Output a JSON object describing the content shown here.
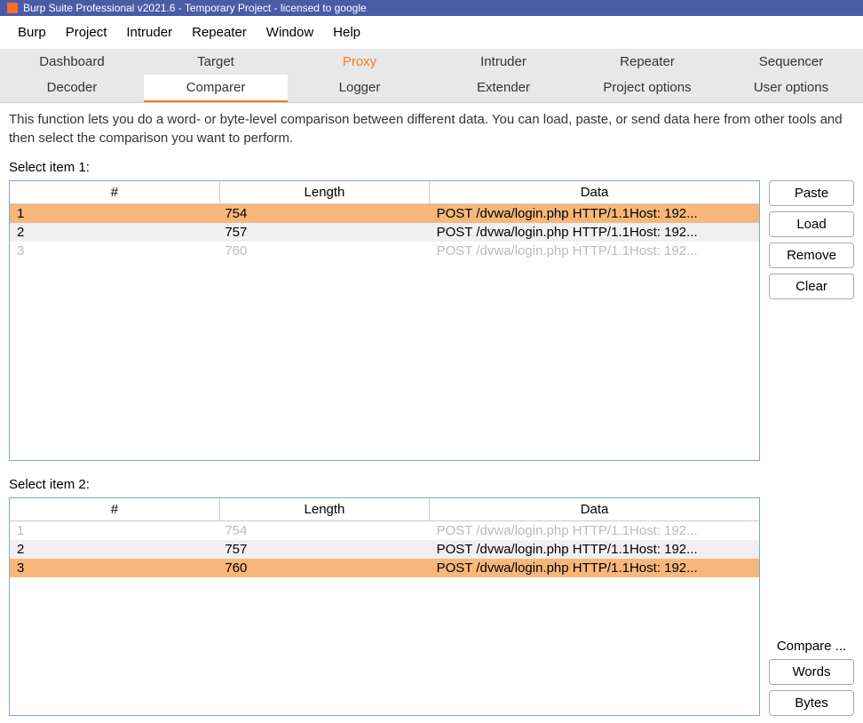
{
  "window": {
    "title": "Burp Suite Professional v2021.6 - Temporary Project - licensed to google"
  },
  "menubar": [
    "Burp",
    "Project",
    "Intruder",
    "Repeater",
    "Window",
    "Help"
  ],
  "tabs_top": [
    "Dashboard",
    "Target",
    "Proxy",
    "Intruder",
    "Repeater",
    "Sequencer"
  ],
  "tabs_sub": [
    "Decoder",
    "Comparer",
    "Logger",
    "Extender",
    "Project options",
    "User options"
  ],
  "description": "This function lets you do a word- or byte-level comparison between different data. You can load, paste, or send data here from other tools and then select the comparison you want to perform.",
  "section1": {
    "label": "Select item 1:",
    "headers": [
      "#",
      "Length",
      "Data"
    ],
    "rows": [
      {
        "n": "1",
        "len": "754",
        "data": "POST /dvwa/login.php HTTP/1.1Host: 192...",
        "selected": true
      },
      {
        "n": "2",
        "len": "757",
        "data": "POST /dvwa/login.php HTTP/1.1Host: 192...",
        "alt": true
      },
      {
        "n": "3",
        "len": "760",
        "data": "POST /dvwa/login.php HTTP/1.1Host: 192...",
        "dim": true
      }
    ],
    "buttons": [
      "Paste",
      "Load",
      "Remove",
      "Clear"
    ]
  },
  "section2": {
    "label": "Select item 2:",
    "headers": [
      "#",
      "Length",
      "Data"
    ],
    "rows": [
      {
        "n": "1",
        "len": "754",
        "data": "POST /dvwa/login.php HTTP/1.1Host: 192...",
        "dim": true
      },
      {
        "n": "2",
        "len": "757",
        "data": "POST /dvwa/login.php HTTP/1.1Host: 192...",
        "alt": true
      },
      {
        "n": "3",
        "len": "760",
        "data": "POST /dvwa/login.php HTTP/1.1Host: 192...",
        "selected": true
      }
    ],
    "compare_label": "Compare ...",
    "buttons": [
      "Words",
      "Bytes"
    ]
  }
}
